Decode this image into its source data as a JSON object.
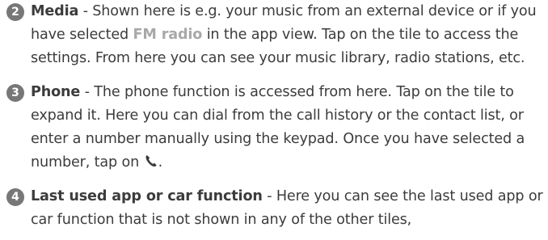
{
  "items": [
    {
      "number": "2",
      "title": "Media",
      "text_1": " - Shown here is e.g. your music from an external device or if you have selected ",
      "highlight": "FM radio",
      "text_2": " in the app view. Tap on the tile to access the settings. From here you can see your music library, radio stations, etc."
    },
    {
      "number": "3",
      "title": "Phone",
      "text_1": " - The phone function is accessed from here. Tap on the tile to expand it. Here you can dial from the call history or the contact list, or enter a number manually using the keypad. Once you have selected a number, tap on ",
      "icon": "phone-icon",
      "text_2": "."
    },
    {
      "number": "4",
      "title": "Last used app or car function",
      "text_1": " - Here you can see the last used app or car function that is not shown in any of the other tiles,"
    }
  ]
}
